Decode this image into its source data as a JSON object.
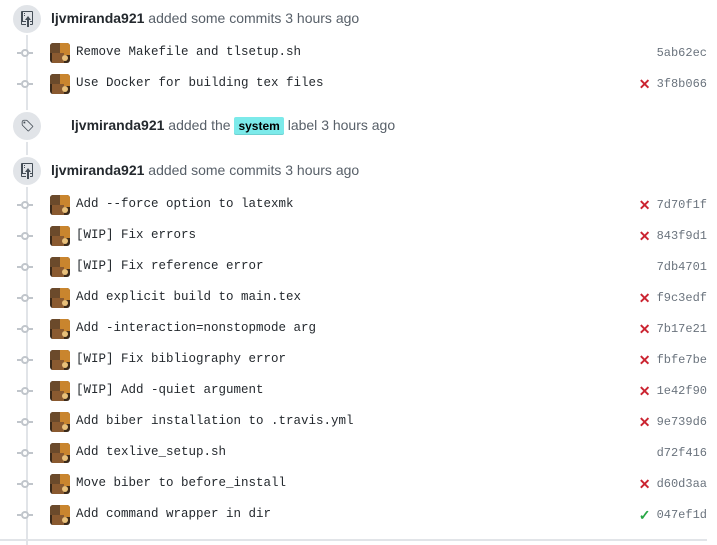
{
  "events": [
    {
      "type": "commits",
      "icon": "repo-push-icon",
      "author": "ljvmiranda921",
      "action": " added some commits ",
      "time": "3 hours ago",
      "commits": [
        {
          "message": "Remove Makefile and tlsetup.sh",
          "sha": "5ab62ec",
          "status": "none"
        },
        {
          "message": "Use Docker for building tex files",
          "sha": "3f8b066",
          "status": "fail"
        }
      ]
    },
    {
      "type": "label",
      "icon": "tag-icon",
      "author": "ljvmiranda921",
      "action_before": " added the ",
      "label": "system",
      "label_color": "#7ceaea",
      "action_after": " label ",
      "time": "3 hours ago"
    },
    {
      "type": "commits",
      "icon": "repo-push-icon",
      "author": "ljvmiranda921",
      "action": " added some commits ",
      "time": "3 hours ago",
      "commits": [
        {
          "message": "Add --force option to latexmk",
          "sha": "7d70f1f",
          "status": "fail"
        },
        {
          "message": "[WIP] Fix errors",
          "sha": "843f9d1",
          "status": "fail"
        },
        {
          "message": "[WIP] Fix reference error",
          "sha": "7db4701",
          "status": "none"
        },
        {
          "message": "Add explicit build to main.tex",
          "sha": "f9c3edf",
          "status": "fail"
        },
        {
          "message": "Add -interaction=nonstopmode arg",
          "sha": "7b17e21",
          "status": "fail"
        },
        {
          "message": "[WIP] Fix bibliography error",
          "sha": "fbfe7be",
          "status": "fail"
        },
        {
          "message": "[WIP] Add -quiet argument",
          "sha": "1e42f90",
          "status": "fail"
        },
        {
          "message": "Add biber installation to .travis.yml",
          "sha": "9e739d6",
          "status": "fail"
        },
        {
          "message": "Add texlive_setup.sh",
          "sha": "d72f416",
          "status": "none"
        },
        {
          "message": "Move biber to before_install",
          "sha": "d60d3aa",
          "status": "fail"
        },
        {
          "message": "Add command wrapper in dir",
          "sha": "047ef1d",
          "status": "success"
        }
      ]
    }
  ],
  "status_glyphs": {
    "fail": "✕",
    "success": "✓",
    "none": ""
  },
  "colors": {
    "fail": "#cb2431",
    "success": "#28a745",
    "label_system": "#7ceaea"
  }
}
